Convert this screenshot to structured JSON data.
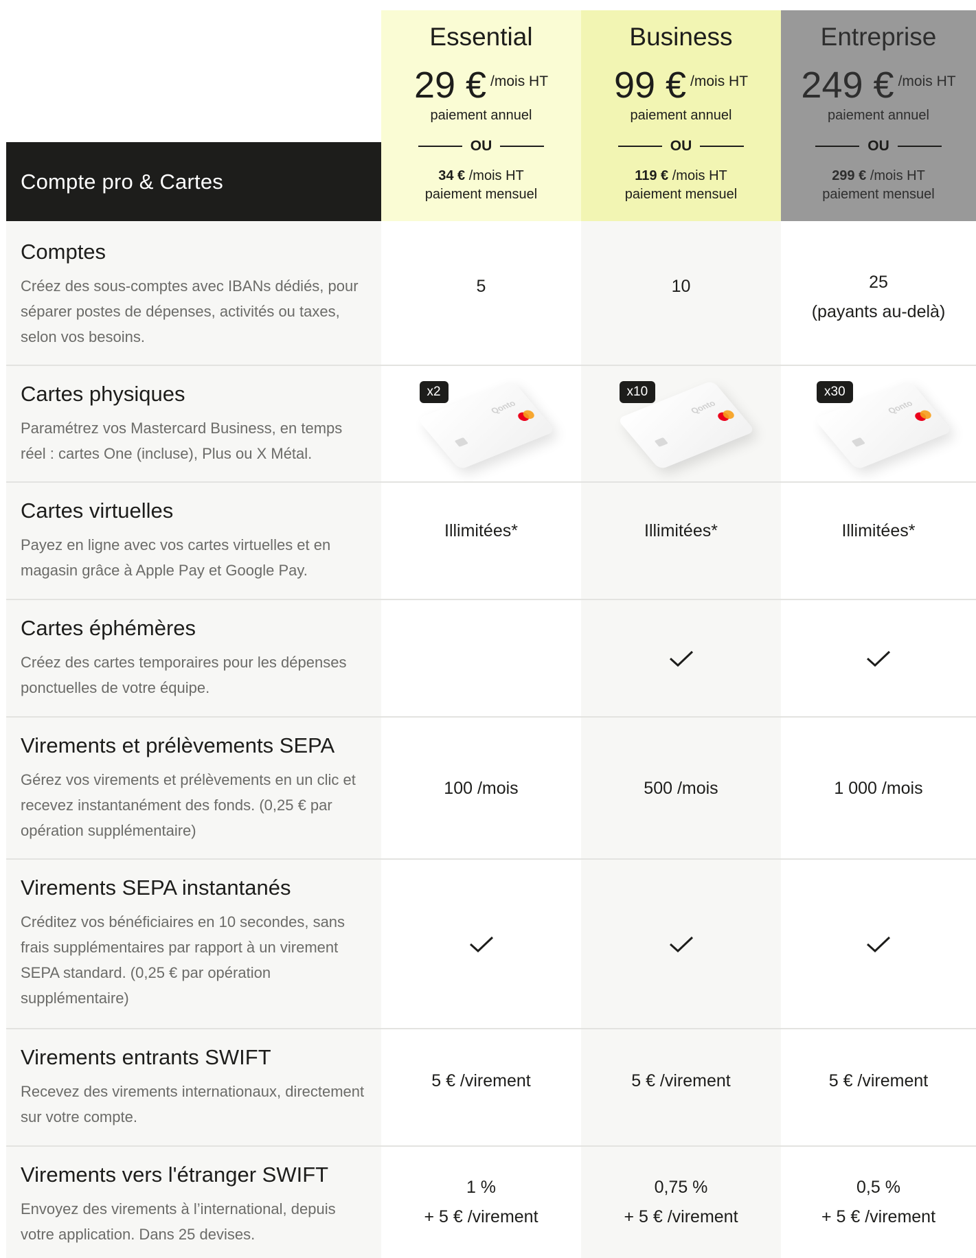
{
  "section_title": "Compte pro & Cartes",
  "plans": [
    {
      "name": "Essential",
      "price": "29 €",
      "unit": "/mois HT",
      "annual": "paiement annuel",
      "or": "OU",
      "monthly_price": "34 €",
      "monthly_unit": "/mois HT",
      "monthly_label": "paiement mensuel",
      "color": "#fafcd4"
    },
    {
      "name": "Business",
      "price": "99 €",
      "unit": "/mois HT",
      "annual": "paiement annuel",
      "or": "OU",
      "monthly_price": "119 €",
      "monthly_unit": "/mois HT",
      "monthly_label": "paiement mensuel",
      "color": "#f2f5b3"
    },
    {
      "name": "Entreprise",
      "price": "249 €",
      "unit": "/mois HT",
      "annual": "paiement annuel",
      "or": "OU",
      "monthly_price": "299 €",
      "monthly_unit": "/mois HT",
      "monthly_label": "paiement mensuel",
      "color": "#999999"
    }
  ],
  "features": [
    {
      "title": "Comptes",
      "desc": "Créez des sous-comptes avec IBANs dédiés, pour séparer postes de dépenses, activités ou taxes, selon vos besoins.",
      "values": [
        {
          "line1": "5"
        },
        {
          "line1": "10"
        },
        {
          "line1": "25",
          "line2": "(payants au-delà)"
        }
      ]
    },
    {
      "title": "Cartes physiques",
      "desc": "Paramétrez vos Mastercard Business, en temps réel : cartes One (incluse), Plus ou X Métal.",
      "cards": [
        {
          "badge": "x2",
          "brand": "Qonto"
        },
        {
          "badge": "x10",
          "brand": "Qonto"
        },
        {
          "badge": "x30",
          "brand": "Qonto"
        }
      ]
    },
    {
      "title": "Cartes virtuelles",
      "desc": "Payez en ligne avec vos cartes virtuelles et en magasin grâce à Apple Pay et Google Pay.",
      "values": [
        {
          "line1": "Illimitées*"
        },
        {
          "line1": "Illimitées*"
        },
        {
          "line1": "Illimitées*"
        }
      ]
    },
    {
      "title": "Cartes éphémères",
      "desc": "Créez des cartes temporaires pour les dépenses ponctuelles de votre équipe.",
      "checks": [
        false,
        true,
        true
      ]
    },
    {
      "title": "Virements et prélèvements SEPA",
      "desc": "Gérez vos virements et prélèvements en un clic et recevez instantanément des fonds. (0,25 € par opération supplémentaire)",
      "values": [
        {
          "line1": "100 /mois"
        },
        {
          "line1": "500 /mois"
        },
        {
          "line1": "1 000 /mois"
        }
      ]
    },
    {
      "title": "Virements SEPA instantanés",
      "desc": "Créditez vos bénéficiaires en 10 secondes, sans frais supplémentaires par rapport à un virement SEPA standard. (0,25 € par opération supplémentaire)",
      "checks": [
        true,
        true,
        true
      ]
    },
    {
      "title": "Virements entrants SWIFT",
      "desc": "Recevez des virements internationaux, directement sur votre compte.",
      "values": [
        {
          "line1": "5 € /virement"
        },
        {
          "line1": "5 € /virement"
        },
        {
          "line1": "5 € /virement"
        }
      ]
    },
    {
      "title": "Virements vers l'étranger SWIFT",
      "desc": "Envoyez des virements à l’international, depuis votre application. Dans 25 devises.",
      "values": [
        {
          "line1": "1 %",
          "line2": "+ 5 € /virement"
        },
        {
          "line1": "0,75 %",
          "line2": "+ 5 € /virement"
        },
        {
          "line1": "0,5 %",
          "line2": "+ 5 € /virement"
        }
      ]
    }
  ]
}
